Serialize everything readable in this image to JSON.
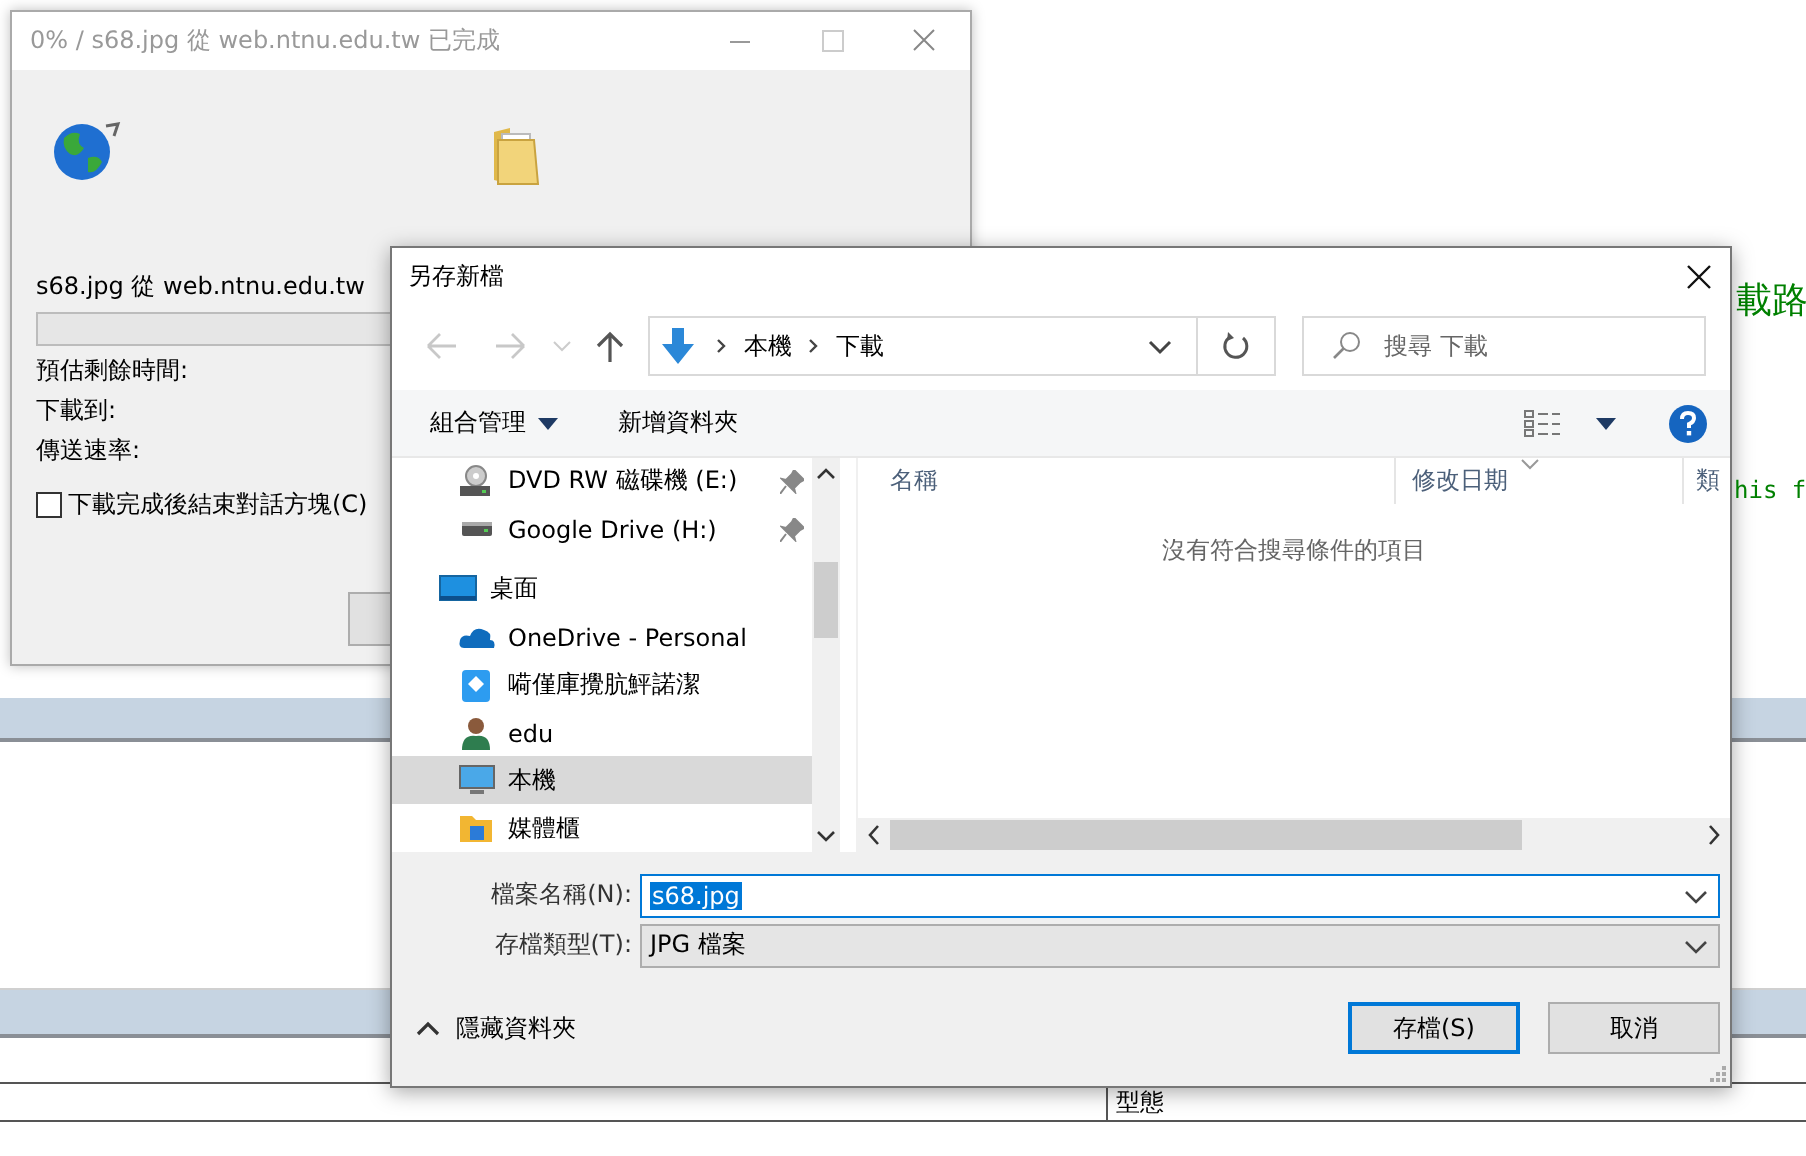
{
  "background": {
    "texts": [
      {
        "text": "載路"
      },
      {
        "text": "his f"
      }
    ],
    "column_header": "型態"
  },
  "download_window": {
    "title": "0% / s68.jpg 從 web.ntnu.edu.tw 已完成",
    "source": "s68.jpg 從 web.ntnu.edu.tw",
    "progress": {
      "level": 0
    },
    "fields": [
      "預估剩餘時間:",
      "下載到:",
      "傳送速率:"
    ],
    "close_when_done": {
      "label": "下載完成後結束對話方塊(C)",
      "checked": false
    }
  },
  "save_dialog": {
    "title": "另存新檔",
    "path": [
      "本機",
      "下載"
    ],
    "search": {
      "placeholder": "搜尋 下載"
    },
    "toolbar": {
      "organize": "組合管理",
      "new_folder": "新增資料夾"
    },
    "nav_items": [
      {
        "label": "DVD RW 磁碟機 (E:)",
        "kind": "dvd",
        "pinned": true,
        "selected": false
      },
      {
        "label": "Google Drive (H:)",
        "kind": "drive",
        "pinned": true,
        "selected": false
      },
      {
        "label": "桌面",
        "kind": "desktop",
        "pinned": false,
        "selected": false
      },
      {
        "label": "OneDrive - Personal",
        "kind": "cloud",
        "pinned": false,
        "selected": false
      },
      {
        "label": "嗬僅庫攪肮鮃諾潔",
        "kind": "app",
        "pinned": false,
        "selected": false
      },
      {
        "label": "edu",
        "kind": "user",
        "pinned": false,
        "selected": false
      },
      {
        "label": "本機",
        "kind": "computer",
        "pinned": false,
        "selected": true
      },
      {
        "label": "媒體櫃",
        "kind": "library",
        "pinned": false,
        "selected": false
      }
    ],
    "columns": [
      "名稱",
      "修改日期",
      "類"
    ],
    "empty_message": "沒有符合搜尋條件的項目",
    "file_name": {
      "label": "檔案名稱(N):",
      "value": "s68.jpg"
    },
    "file_type": {
      "label": "存檔類型(T):",
      "value": "JPG 檔案"
    },
    "hide_folders": "隱藏資料夾",
    "buttons": [
      {
        "label": "存檔(S)",
        "kind": "primary"
      },
      {
        "label": "取消",
        "kind": "normal"
      }
    ]
  }
}
